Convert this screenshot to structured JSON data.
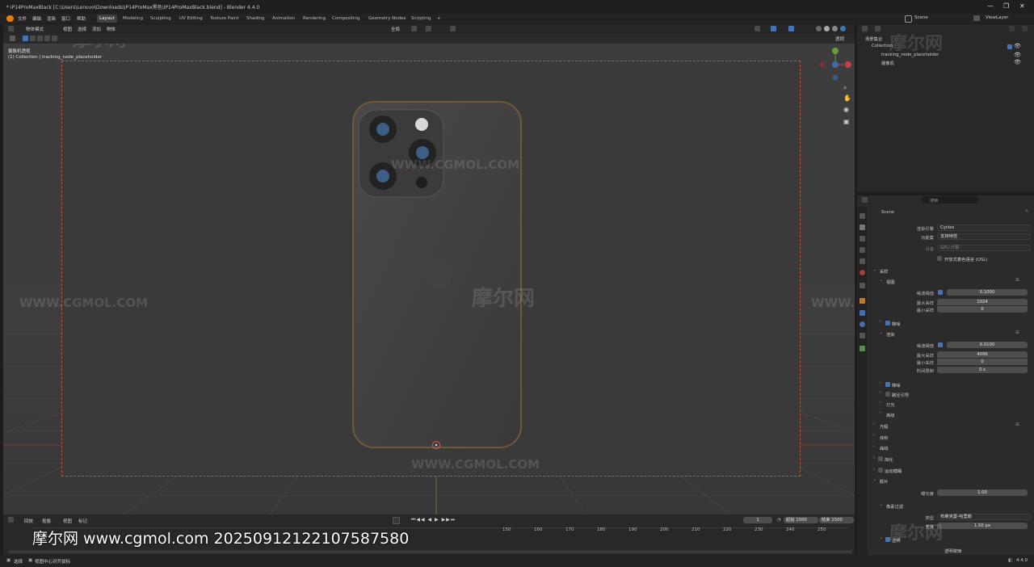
{
  "title_bar": {
    "title": "* iP14ProMaxBlack [C:\\Users\\Lenovo\\Downloads\\iP14ProMax黑色\\iP14ProMaxBlack.blend] - Blender 4.4.0",
    "minimize": "—",
    "maximize": "❐",
    "close": "✕"
  },
  "menu": {
    "items": [
      "文件",
      "编辑",
      "渲染",
      "窗口",
      "帮助"
    ],
    "workspaces": [
      "Layout",
      "Modeling",
      "Sculpting",
      "UV Editing",
      "Texture Paint",
      "Shading",
      "Animation",
      "Rendering",
      "Compositing",
      "Geometry Nodes",
      "Scripting"
    ],
    "active_workspace": "Layout",
    "add_tab": "+",
    "scene_label": "Scene",
    "view_layer_label": "ViewLayer"
  },
  "viewport_header": {
    "mode": "物体模式",
    "menus": [
      "视图",
      "选择",
      "添加",
      "物体"
    ],
    "transform_orientation": "全局",
    "view_label": "透视"
  },
  "viewport": {
    "overlay_title": "摄像机透视",
    "overlay_subtitle": "(1) Collection | tracking_node_placeholder",
    "accent_color": "#b8563a"
  },
  "outliner": {
    "search_placeholder": "",
    "root": "场景集合",
    "collection": "Collection",
    "items": [
      "tracking_node_placeholder",
      "摄像机"
    ]
  },
  "properties": {
    "search_placeholder": "搜索",
    "scene_name": "Scene",
    "render_engine_label": "渲染引擎",
    "render_engine": "Cycles",
    "feature_set_label": "功能集",
    "feature_set": "支持特性",
    "device_label": "设备",
    "device": "GPU 计算",
    "osl_label": "开放式着色语言 (OSL)",
    "sampling_label": "采样",
    "viewport_label": "视图",
    "vp_noise_label": "噪波阈值",
    "vp_noise_value": "0.1000",
    "vp_max_label": "最大采样",
    "vp_max_value": "1024",
    "vp_min_label": "最小采样",
    "vp_min_value": "0",
    "vp_denoise_label": "降噪",
    "render_label": "渲染",
    "r_noise_label": "噪波阈值",
    "r_noise_value": "0.0100",
    "r_max_label": "最大采样",
    "r_max_value": "4096",
    "r_min_label": "最小采样",
    "r_min_value": "0",
    "r_time_label": "时间限制",
    "r_time_value": "0 s",
    "r_denoise_label": "降噪",
    "path_guiding_label": "路径引导",
    "lights_label": "灯光",
    "advanced_label": "高级",
    "light_paths_label": "光程",
    "volumes_label": "体积",
    "curves_label": "曲线",
    "simplify_label": "简化",
    "motion_blur_label": "运动模糊",
    "film_label": "胶片",
    "exposure_label": "曝光度",
    "exposure_value": "1.00",
    "pixel_filter_label": "像素过滤",
    "filter_type_label": "类型",
    "filter_type_value": "布莱克曼-哈里斯",
    "filter_width_label": "宽度",
    "filter_width_value": "1.50 px",
    "transparent_label": "透明",
    "transparent_glass_label": "透明玻璃"
  },
  "timeline": {
    "menus": [
      "回放",
      "抠像",
      "视图",
      "标记"
    ],
    "current_frame": "1",
    "start_label": "起始",
    "start_value": "1500",
    "end_label": "结束",
    "end_value": "1500",
    "ticks": [
      "150",
      "160",
      "170",
      "180",
      "190",
      "200",
      "210",
      "220",
      "230",
      "240",
      "250"
    ]
  },
  "statusbar": {
    "left_text": "选择",
    "mid_text": "视图中心对齐鼠标",
    "version": "4.4.0"
  },
  "watermarks": {
    "brand": "摩尔网",
    "site": "WWW.CGMOL.COM",
    "caption": "摩尔网 www.cgmol.com 20250912122107587580"
  }
}
